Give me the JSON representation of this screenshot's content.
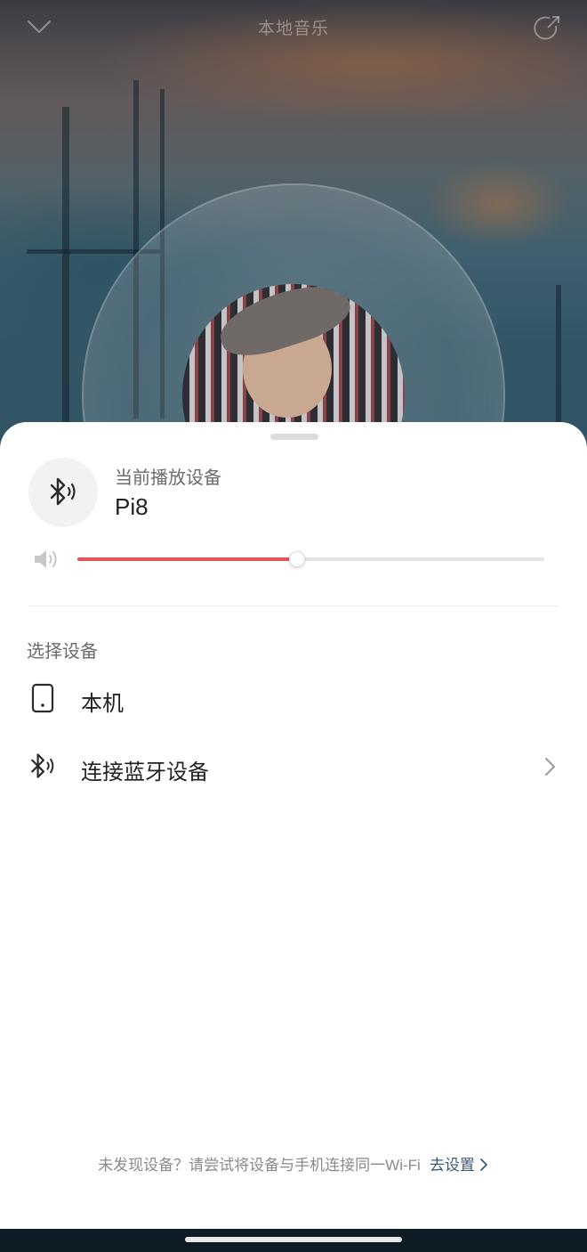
{
  "header": {
    "title": "本地音乐",
    "collapse_icon": "chevron-down-icon",
    "share_icon": "share-icon"
  },
  "sheet": {
    "current_device_label": "当前播放设备",
    "current_device_name": "Pi8",
    "current_device_icon": "bluetooth-audio-icon",
    "volume": {
      "icon": "speaker-icon",
      "level_percent": 47,
      "fill_color": "#e4555a"
    },
    "section_title": "选择设备",
    "options": [
      {
        "label": "本机",
        "icon": "phone-icon",
        "has_chevron": false
      },
      {
        "label": "连接蓝牙设备",
        "icon": "bluetooth-audio-icon",
        "has_chevron": true
      }
    ],
    "hint_text": "未发现设备？请尝试将设备与手机连接同一Wi-Fi",
    "hint_link": "去设置"
  }
}
